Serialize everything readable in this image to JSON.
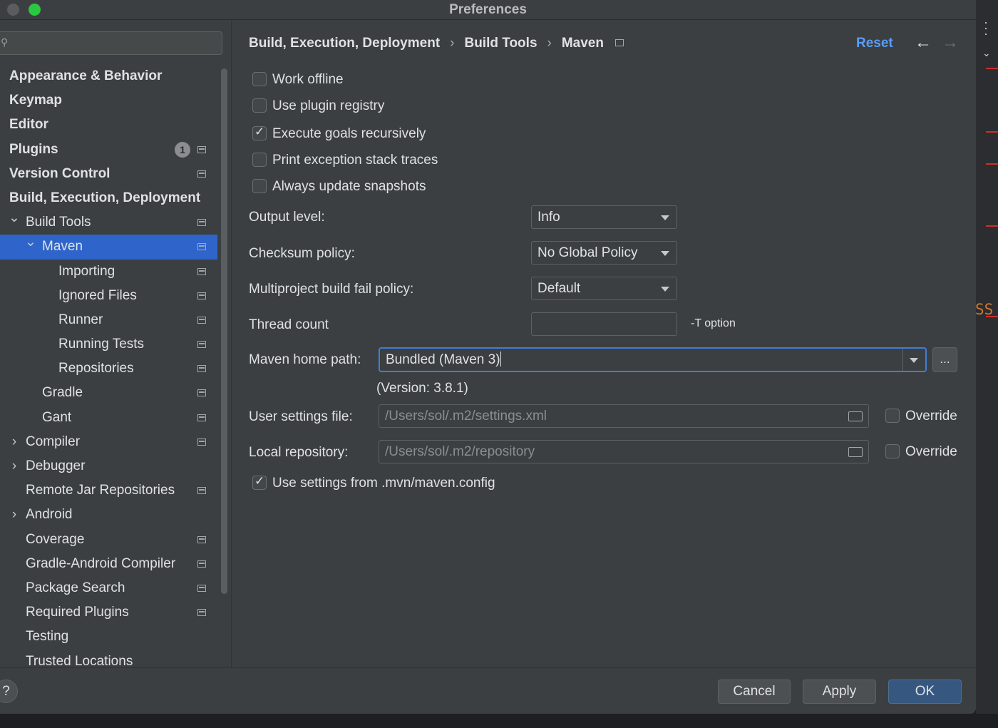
{
  "window": {
    "title": "Preferences"
  },
  "sidebar": {
    "search_placeholder": "",
    "items": [
      {
        "label": "Appearance & Behavior",
        "bold": true,
        "indent": 0,
        "chevron": "",
        "icon": false,
        "badge": ""
      },
      {
        "label": "Keymap",
        "bold": true,
        "indent": 0,
        "chevron": "",
        "icon": false,
        "badge": ""
      },
      {
        "label": "Editor",
        "bold": true,
        "indent": 0,
        "chevron": "",
        "icon": false,
        "badge": ""
      },
      {
        "label": "Plugins",
        "bold": true,
        "indent": 0,
        "chevron": "",
        "icon": true,
        "badge": "1"
      },
      {
        "label": "Version Control",
        "bold": true,
        "indent": 0,
        "chevron": "",
        "icon": true,
        "badge": ""
      },
      {
        "label": "Build, Execution, Deployment",
        "bold": true,
        "indent": 0,
        "chevron": "",
        "icon": false,
        "badge": ""
      },
      {
        "label": "Build Tools",
        "bold": false,
        "indent": 1,
        "chevron": "down",
        "icon": true,
        "badge": ""
      },
      {
        "label": "Maven",
        "bold": false,
        "indent": 2,
        "chevron": "down",
        "icon": true,
        "badge": "",
        "selected": true
      },
      {
        "label": "Importing",
        "bold": false,
        "indent": 3,
        "chevron": "",
        "icon": true,
        "badge": ""
      },
      {
        "label": "Ignored Files",
        "bold": false,
        "indent": 3,
        "chevron": "",
        "icon": true,
        "badge": ""
      },
      {
        "label": "Runner",
        "bold": false,
        "indent": 3,
        "chevron": "",
        "icon": true,
        "badge": ""
      },
      {
        "label": "Running Tests",
        "bold": false,
        "indent": 3,
        "chevron": "",
        "icon": true,
        "badge": ""
      },
      {
        "label": "Repositories",
        "bold": false,
        "indent": 3,
        "chevron": "",
        "icon": true,
        "badge": ""
      },
      {
        "label": "Gradle",
        "bold": false,
        "indent": 2,
        "chevron": "",
        "icon": true,
        "badge": ""
      },
      {
        "label": "Gant",
        "bold": false,
        "indent": 2,
        "chevron": "",
        "icon": true,
        "badge": ""
      },
      {
        "label": "Compiler",
        "bold": false,
        "indent": 1,
        "chevron": "right",
        "icon": true,
        "badge": ""
      },
      {
        "label": "Debugger",
        "bold": false,
        "indent": 1,
        "chevron": "right",
        "icon": false,
        "badge": ""
      },
      {
        "label": "Remote Jar Repositories",
        "bold": false,
        "indent": 1,
        "chevron": "",
        "icon": true,
        "badge": ""
      },
      {
        "label": "Android",
        "bold": false,
        "indent": 1,
        "chevron": "right",
        "icon": false,
        "badge": ""
      },
      {
        "label": "Coverage",
        "bold": false,
        "indent": 1,
        "chevron": "",
        "icon": true,
        "badge": ""
      },
      {
        "label": "Gradle-Android Compiler",
        "bold": false,
        "indent": 1,
        "chevron": "",
        "icon": true,
        "badge": ""
      },
      {
        "label": "Package Search",
        "bold": false,
        "indent": 1,
        "chevron": "",
        "icon": true,
        "badge": ""
      },
      {
        "label": "Required Plugins",
        "bold": false,
        "indent": 1,
        "chevron": "",
        "icon": true,
        "badge": ""
      },
      {
        "label": "Testing",
        "bold": false,
        "indent": 1,
        "chevron": "",
        "icon": false,
        "badge": ""
      },
      {
        "label": "Trusted Locations",
        "bold": false,
        "indent": 1,
        "chevron": "",
        "icon": false,
        "badge": ""
      }
    ]
  },
  "breadcrumb": [
    "Build, Execution, Deployment",
    "Build Tools",
    "Maven"
  ],
  "header": {
    "reset_label": "Reset",
    "back_icon": "arrow-left-icon",
    "forward_icon": "arrow-right-icon"
  },
  "options": {
    "work_offline": {
      "label": "Work offline",
      "checked": false
    },
    "use_plugin_registry": {
      "label": "Use plugin registry",
      "checked": false
    },
    "execute_goals_recursively": {
      "label": "Execute goals recursively",
      "checked": true
    },
    "print_exception_stack_traces": {
      "label": "Print exception stack traces",
      "checked": false
    },
    "always_update_snapshots": {
      "label": "Always update snapshots",
      "checked": false
    }
  },
  "fields": {
    "output_level": {
      "label": "Output level:",
      "value": "Info"
    },
    "checksum_policy": {
      "label": "Checksum policy:",
      "value": "No Global Policy"
    },
    "multiproject_fail_policy": {
      "label": "Multiproject build fail policy:",
      "value": "Default"
    },
    "thread_count": {
      "label": "Thread count",
      "value": "",
      "hint": "-T option"
    },
    "maven_home": {
      "label": "Maven home path:",
      "value": "Bundled (Maven 3)",
      "version": "(Version: 3.8.1)",
      "browse_label": "..."
    },
    "user_settings": {
      "label": "User settings file:",
      "placeholder": "/Users/sol/.m2/settings.xml",
      "override_label": "Override",
      "override_checked": false
    },
    "local_repository": {
      "label": "Local repository:",
      "placeholder": "/Users/sol/.m2/repository",
      "override_label": "Override",
      "override_checked": false
    }
  },
  "use_mvn_config": {
    "label": "Use settings from .mvn/maven.config",
    "checked": true
  },
  "footer": {
    "help_label": "?",
    "cancel_label": "Cancel",
    "apply_label": "Apply",
    "ok_label": "OK"
  },
  "background_editor": {
    "code_fragment": "SS"
  },
  "colors": {
    "accent": "#2f65ca",
    "link": "#589df6",
    "primary_button": "#365880",
    "focus_border": "#3d7dd9"
  }
}
